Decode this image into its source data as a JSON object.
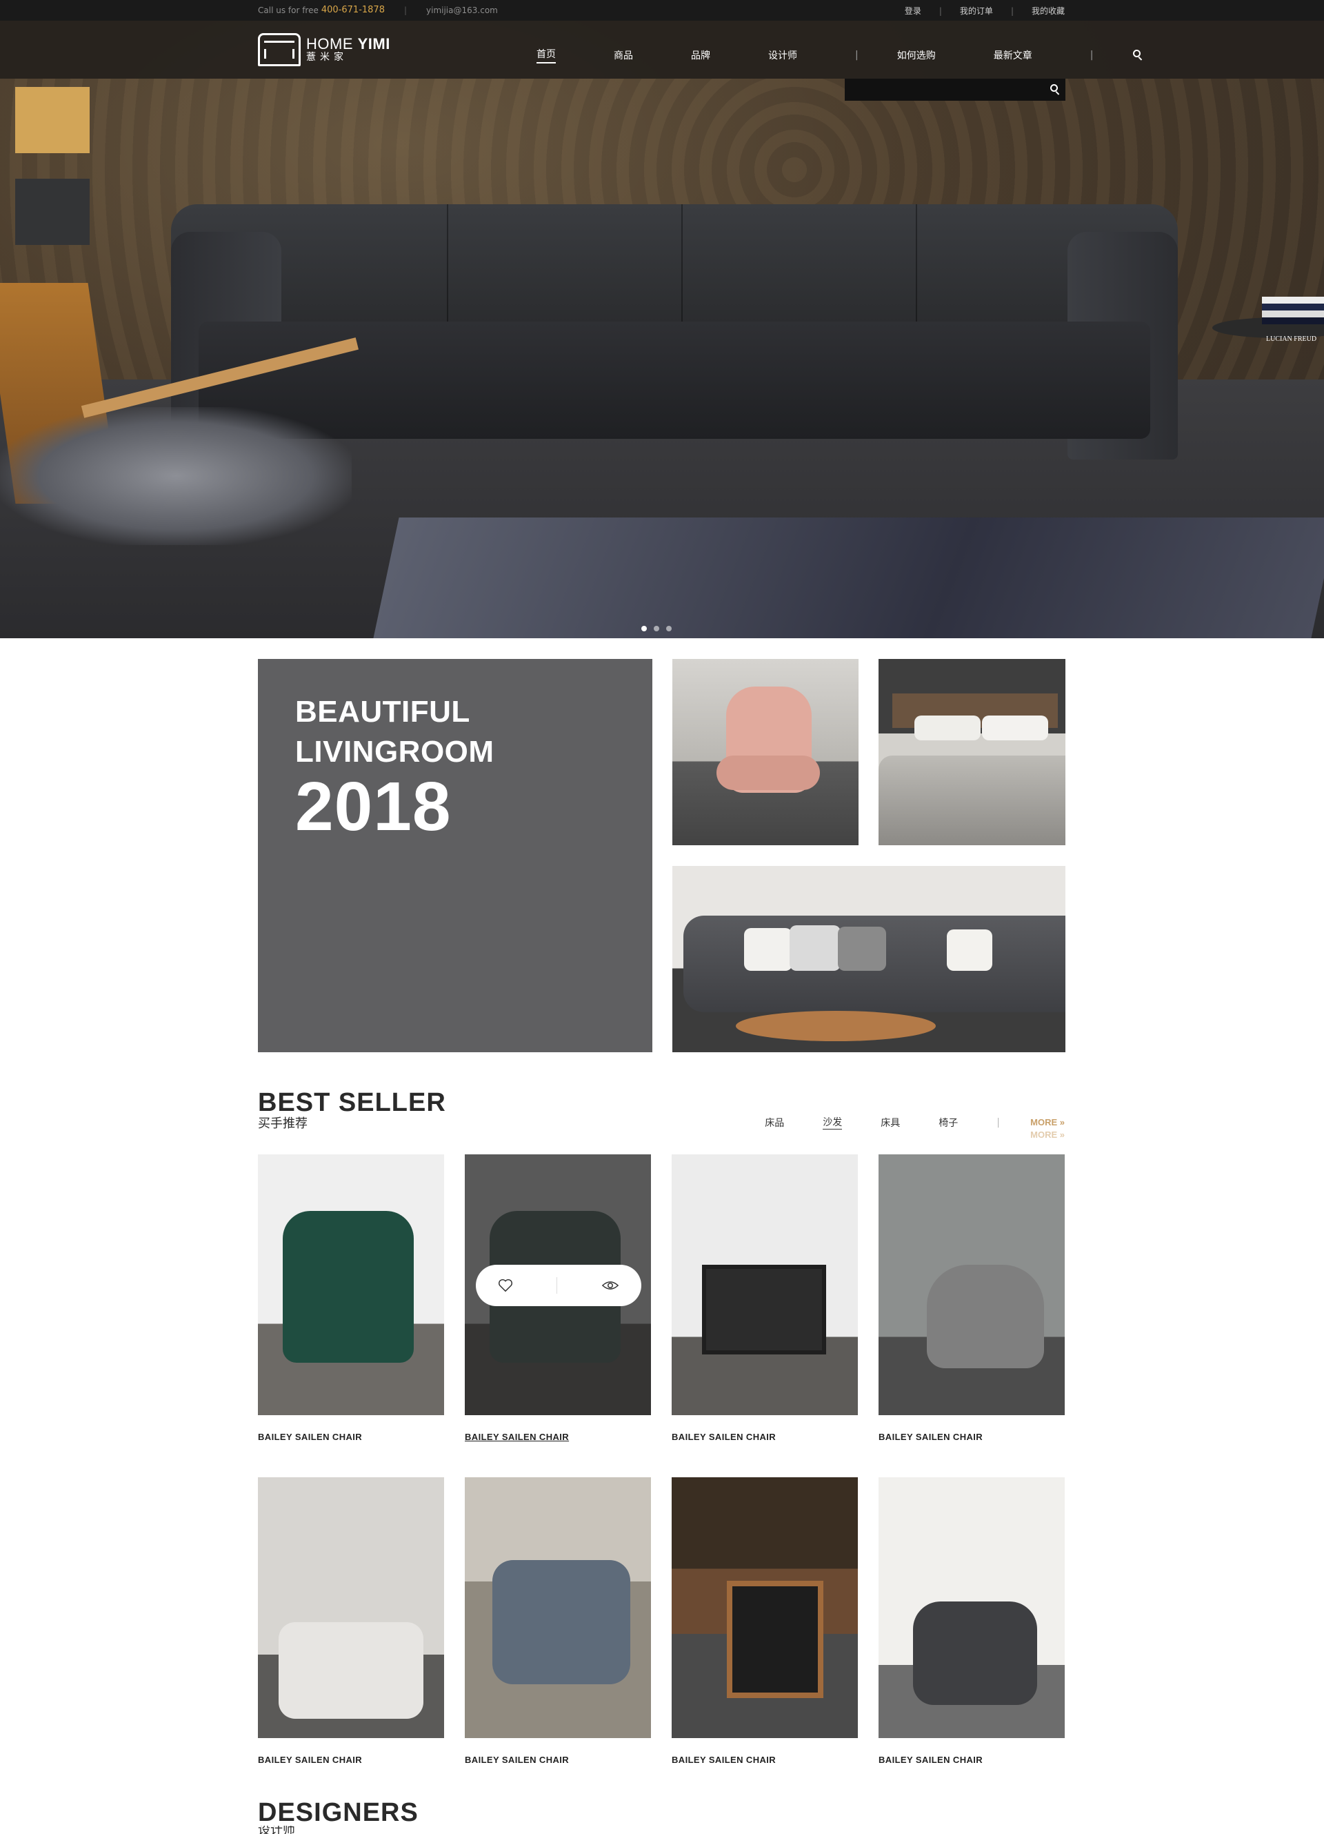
{
  "topbar": {
    "call_label": "Call us for free",
    "phone": "400-671-1878",
    "email": "yimijia@163.com",
    "login": "登录",
    "orders": "我的订单",
    "favorites": "我的收藏"
  },
  "header": {
    "logo_word_1": "HOME",
    "logo_word_2": "YIMI",
    "logo_cn": "薏米家",
    "nav": [
      "首页",
      "商品",
      "品牌",
      "设计师",
      "如何选购",
      "最新文章"
    ],
    "search_placeholder": ""
  },
  "hero": {
    "book_label": "LUCIAN FREUD",
    "slide_count": 3,
    "active_slide": 1,
    "swatches": [
      "#d2a558",
      "#333436"
    ]
  },
  "feature": {
    "line1": "BEAUTIFUL",
    "line2": "LIVINGROOM",
    "year": "2018"
  },
  "best_seller": {
    "title_en": "BEST SELLER",
    "title_cn": "买手推荐",
    "filters": [
      "床品",
      "沙发",
      "床具",
      "椅子"
    ],
    "active_filter": "沙发",
    "more": "MORE",
    "more_arrow": "»",
    "products": [
      {
        "name": "BAILEY SAILEN CHAIR"
      },
      {
        "name": "BAILEY SAILEN CHAIR"
      },
      {
        "name": "BAILEY SAILEN CHAIR"
      },
      {
        "name": "BAILEY SAILEN CHAIR"
      },
      {
        "name": "BAILEY SAILEN CHAIR"
      },
      {
        "name": "BAILEY SAILEN CHAIR"
      },
      {
        "name": "BAILEY SAILEN CHAIR"
      },
      {
        "name": "BAILEY SAILEN CHAIR"
      }
    ]
  },
  "designers": {
    "title_en": "DESIGNERS",
    "title_cn": "设计师"
  },
  "colors": {
    "accent_gold": "#d8a649",
    "more_gold": "#c9a06a",
    "topbar_bg": "#1a1a1a",
    "feature_bg": "#5f5f61"
  }
}
